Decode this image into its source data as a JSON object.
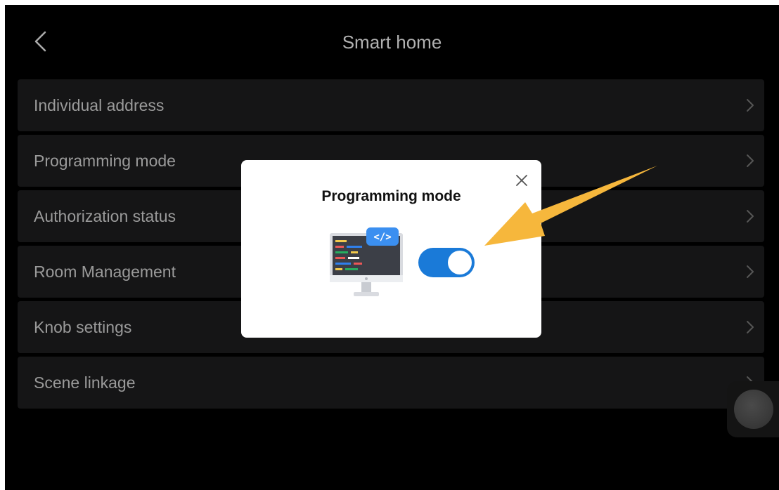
{
  "header": {
    "title": "Smart home"
  },
  "menu": {
    "items": [
      {
        "label": "Individual address"
      },
      {
        "label": "Programming mode"
      },
      {
        "label": "Authorization status"
      },
      {
        "label": "Room Management"
      },
      {
        "label": "Knob settings"
      },
      {
        "label": "Scene linkage"
      }
    ]
  },
  "dialog": {
    "title": "Programming mode",
    "toggle_on": true,
    "code_badge_text": "</>"
  },
  "colors": {
    "background": "#000000",
    "menu_item_bg": "#1a1a1b",
    "toggle_on": "#1a7ad8",
    "arrow": "#f6b73c"
  },
  "icons": {
    "back": "chevron-left-icon",
    "item_chevron": "chevron-right-icon",
    "close": "close-icon",
    "illustration": "computer-code-icon"
  }
}
